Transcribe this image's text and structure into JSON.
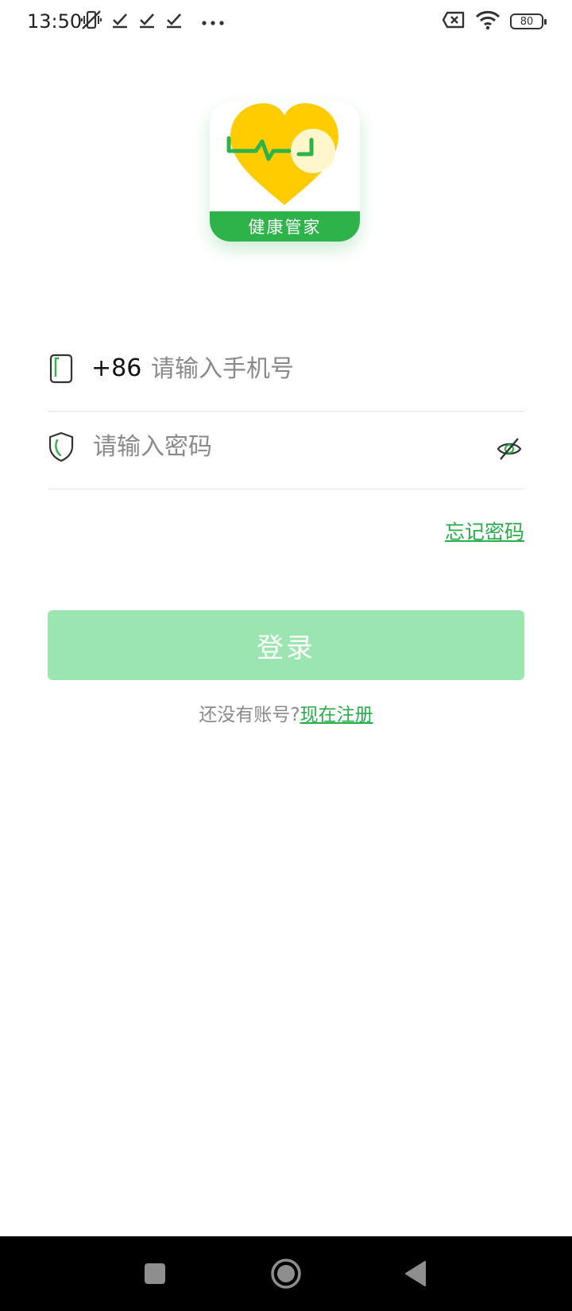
{
  "status_bar": {
    "time": "13:50",
    "battery_level": "80",
    "icons": [
      "mute-vibrate-icon",
      "check-icon",
      "check-icon",
      "check-icon",
      "more-dots-icon",
      "no-sim-icon",
      "wifi-icon",
      "battery-icon"
    ]
  },
  "app": {
    "name": "健康管家",
    "logo_icon": "heart-pulse-clock-icon",
    "brand_color": "#27ae4a",
    "heart_color": "#ffcc00"
  },
  "login_form": {
    "country_code": "+86",
    "phone_placeholder": "请输入手机号",
    "phone_value": "",
    "password_placeholder": "请输入密码",
    "password_value": "",
    "password_visibility_icon": "eye-off-icon",
    "forgot_password": "忘记密码",
    "login_button": "登录",
    "login_button_color": "#9be6b0",
    "no_account_prompt": "还没有账号?",
    "register_link": "现在注册"
  },
  "nav_bar": {
    "icons": [
      "recent-apps-icon",
      "home-icon",
      "back-icon"
    ]
  }
}
